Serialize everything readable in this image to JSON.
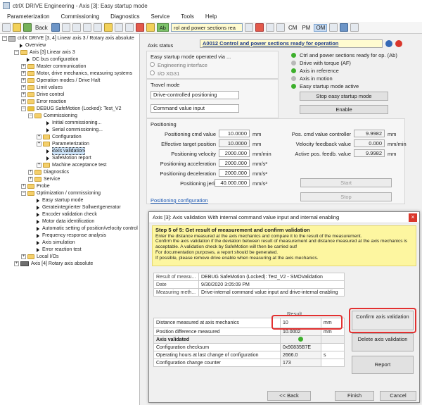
{
  "window": {
    "title": "ctrlX DRIVE Engineering - Axis [3]: Easy startup mode"
  },
  "menu": [
    "Parameterization",
    "Commissioning",
    "Diagnostics",
    "Service",
    "Tools",
    "Help"
  ],
  "toolbar": {
    "back": "Back",
    "ab": "Ab",
    "status_combo": "rol and power sections rea",
    "cm": "CM",
    "pm": "PM",
    "om": "OM"
  },
  "tree": {
    "root": "ctrlX DRIVE [3, 4] Linear axis 3 / Rotary axis absolute",
    "items": [
      {
        "label": "Overview"
      },
      {
        "label": "Axis [3] Linear axis 3"
      },
      {
        "label": "DC bus configuration"
      },
      {
        "label": "Master communication"
      },
      {
        "label": "Motor, drive mechanics, measuring systems"
      },
      {
        "label": "Operation modes / Drive Halt"
      },
      {
        "label": "Limit values"
      },
      {
        "label": "Drive control"
      },
      {
        "label": "Error reaction"
      },
      {
        "label": "DEBUG SafeMotion (Locked): Test_V2"
      },
      {
        "label": "Commissioning"
      },
      {
        "label": "Initial commissioning..."
      },
      {
        "label": "Serial commissioning..."
      },
      {
        "label": "Configuration"
      },
      {
        "label": "Parameterization"
      },
      {
        "label": "Axis validation"
      },
      {
        "label": "SafeMotion report"
      },
      {
        "label": "Machine acceptance test"
      },
      {
        "label": "Diagnostics"
      },
      {
        "label": "Service"
      },
      {
        "label": "Probe"
      },
      {
        "label": "Optimization / commissioning"
      },
      {
        "label": "Easy startup mode"
      },
      {
        "label": "Gerateintegrierter Sollwertgenerator"
      },
      {
        "label": "Encoder validation check"
      },
      {
        "label": "Motor data identification"
      },
      {
        "label": "Automatic setting of position/velocity control"
      },
      {
        "label": "Frequency response analysis"
      },
      {
        "label": "Axis simulation"
      },
      {
        "label": "Error reaction test"
      },
      {
        "label": "Local I/Os"
      },
      {
        "label": "Axis [4] Rotary axis absolute"
      }
    ]
  },
  "axis_status": {
    "label": "Axis status",
    "value": "A0012 Control and power sections ready for operation"
  },
  "easy_startup": {
    "label": "Easy startup mode operated via ...",
    "radio1": "Engineering interface",
    "radio2": "I/O XG31",
    "leds": [
      "Ctrl and power sections ready for op. (Ab)",
      "Drive with torque (AF)",
      "Axis in reference",
      "Axis in motion",
      "Easy startup mode active"
    ],
    "stop_btn": "Stop easy startup mode",
    "enable_btn": "Enable"
  },
  "travel": {
    "label": "Travel mode",
    "mode": "Drive-controlled positioning",
    "input": "Command value input"
  },
  "positioning": {
    "label": "Positioning",
    "rows": [
      {
        "label": "Positioning cmd value",
        "value": "10.0000",
        "unit": "mm"
      },
      {
        "label": "Effective target position",
        "value": "10.0000",
        "unit": "mm"
      },
      {
        "label": "Positioning velocity",
        "value": "2000.000",
        "unit": "mm/min"
      },
      {
        "label": "Positioning acceleration",
        "value": "2000.000",
        "unit": "mm/s²"
      },
      {
        "label": "Positioning deceleration",
        "value": "2000.000",
        "unit": "mm/s²"
      },
      {
        "label": "Positioning jerk",
        "value": "40.000.000",
        "unit": "mm/s³"
      }
    ],
    "right": [
      {
        "label": "Pos. cmd value controller",
        "value": "9.9982",
        "unit": "mm"
      },
      {
        "label": "Velocity feedback value",
        "value": "0.000",
        "unit": "mm/min"
      },
      {
        "label": "Active pos. feedb. value",
        "value": "9.9982",
        "unit": "mm"
      }
    ],
    "start": "Start",
    "stop": "Stop",
    "link": "Positioning configuration"
  },
  "dialog": {
    "title": "Axis [3]: Axis validation With internal command value input and internal enabling",
    "step": "Step 5 of 5: Get result of measurement and confirm validation",
    "info": [
      "Enter the distance measured at the axis mechanics and compare it to the result of the measurement.",
      "Confirm the axis validation if the deviation between result of measurement and distance measured at the axis mechanics is",
      "acceptable. A validation check by SafeMotion will then be carried out!",
      "For documentation purposes, a report should be generated.",
      "If possible, please remove drive enable when measuring at the axis mechanics."
    ],
    "meta": [
      {
        "k": "Result of measu...",
        "v": "DEBUG SafeMotion (Locked): Test_V2 - SMOValidation"
      },
      {
        "k": "Date",
        "v": "9/30/2020 3:05:09 PM"
      },
      {
        "k": "Measuring meth...",
        "v": "Drive-internal command value input and drive-internal enabling"
      }
    ],
    "result_header": "Result",
    "dist_label": "Distance measured at axis mechanics",
    "dist_value": "10",
    "dist_unit": "mm",
    "diff_label": "Position difference measured",
    "diff_value": "10.0002",
    "diff_unit": "mm",
    "validated_label": "Axis validated",
    "checksum_label": "Configuration checksum",
    "checksum_value": "0x90835B7E",
    "hours_label": "Operating hours at last change of configuration",
    "hours_value": "2666.0",
    "hours_unit": "s",
    "counter_label": "Configuration change counter",
    "counter_value": "173",
    "confirm_btn": "Confirm axis validation",
    "delete_btn": "Delete axis validation",
    "report_btn": "Report",
    "back_btn": "<< Back",
    "finish_btn": "Finish",
    "cancel_btn": "Cancel"
  },
  "colors": {
    "led_green": "#3daf2c",
    "led_gray": "#b8b8b8",
    "highlight": "#e23030",
    "info_bg": "#fdf6a0",
    "status_bg": "#fffbd0"
  }
}
